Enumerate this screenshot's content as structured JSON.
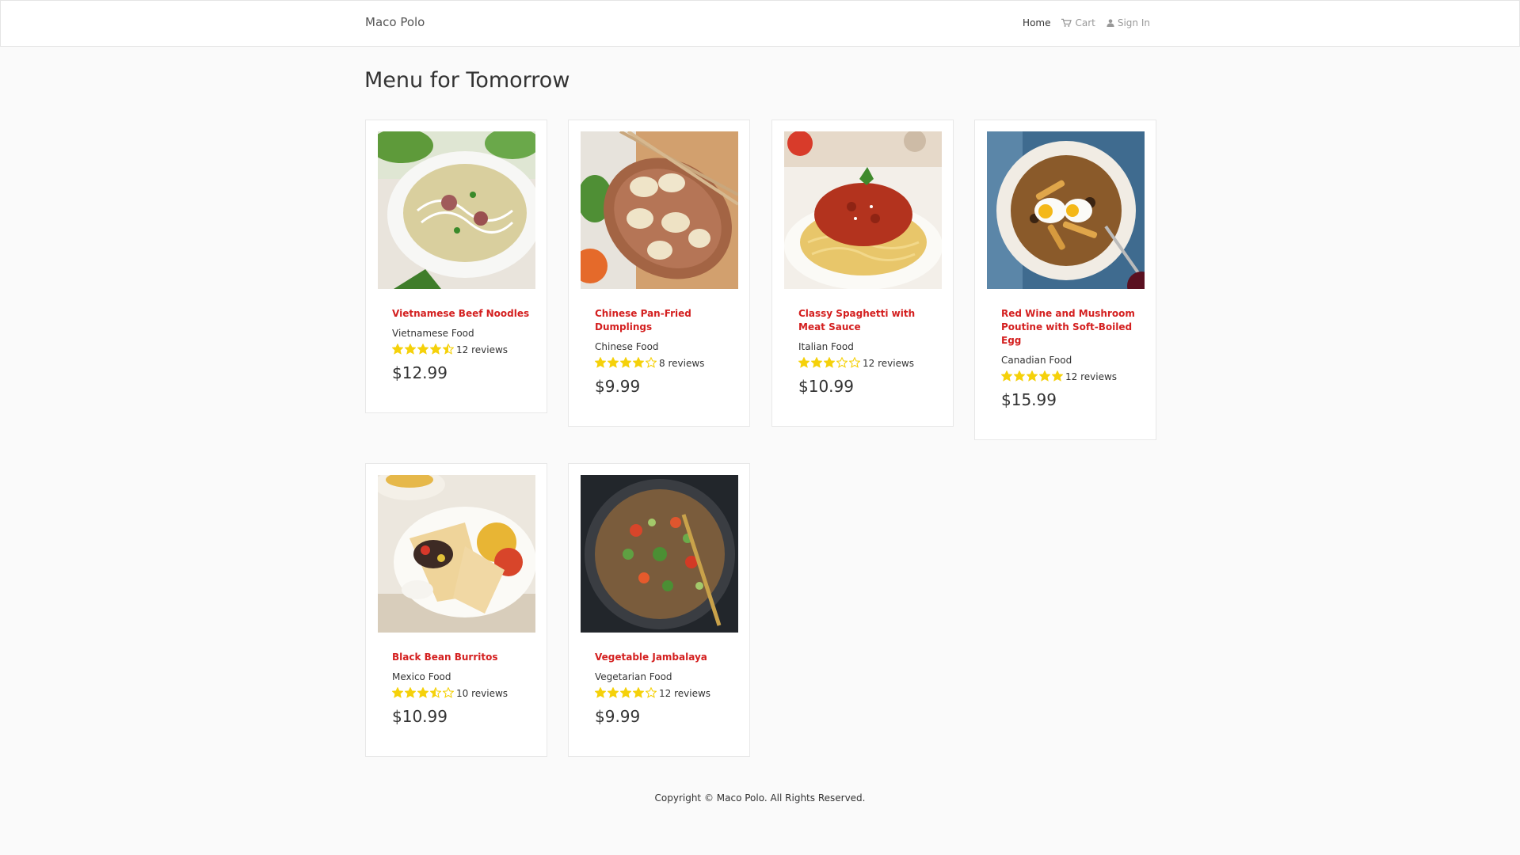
{
  "nav": {
    "brand": "Maco Polo",
    "home": "Home",
    "cart": "Cart",
    "sign_in": "Sign In"
  },
  "page_title": "Menu for Tomorrow",
  "items": [
    {
      "name": "Vietnamese Beef Noodles",
      "cuisine": "Vietnamese Food",
      "rating": 4.5,
      "reviews": "12 reviews",
      "price": "$12.99",
      "image": "beef-noodle-soup-photo"
    },
    {
      "name": "Chinese Pan-Fried Dumplings",
      "cuisine": "Chinese Food",
      "rating": 4,
      "reviews": "8 reviews",
      "price": "$9.99",
      "image": "dumplings-photo"
    },
    {
      "name": "Classy Spaghetti with Meat Sauce",
      "cuisine": "Italian Food",
      "rating": 3,
      "reviews": "12 reviews",
      "price": "$10.99",
      "image": "spaghetti-photo"
    },
    {
      "name": "Red Wine and Mushroom Poutine with Soft-Boiled Egg",
      "cuisine": "Canadian Food",
      "rating": 5,
      "reviews": "12 reviews",
      "price": "$15.99",
      "image": "poutine-photo"
    },
    {
      "name": "Black Bean Burritos",
      "cuisine": "Mexico Food",
      "rating": 3.5,
      "reviews": "10 reviews",
      "price": "$10.99",
      "image": "burrito-photo"
    },
    {
      "name": "Vegetable Jambalaya",
      "cuisine": "Vegetarian Food",
      "rating": 4,
      "reviews": "12 reviews",
      "price": "$9.99",
      "image": "jambalaya-photo"
    }
  ],
  "colors": {
    "accent": "#d42020",
    "star": "#f5d10a",
    "background": "#fafafa"
  },
  "footer": "Copyright © Maco Polo. All Rights Reserved."
}
